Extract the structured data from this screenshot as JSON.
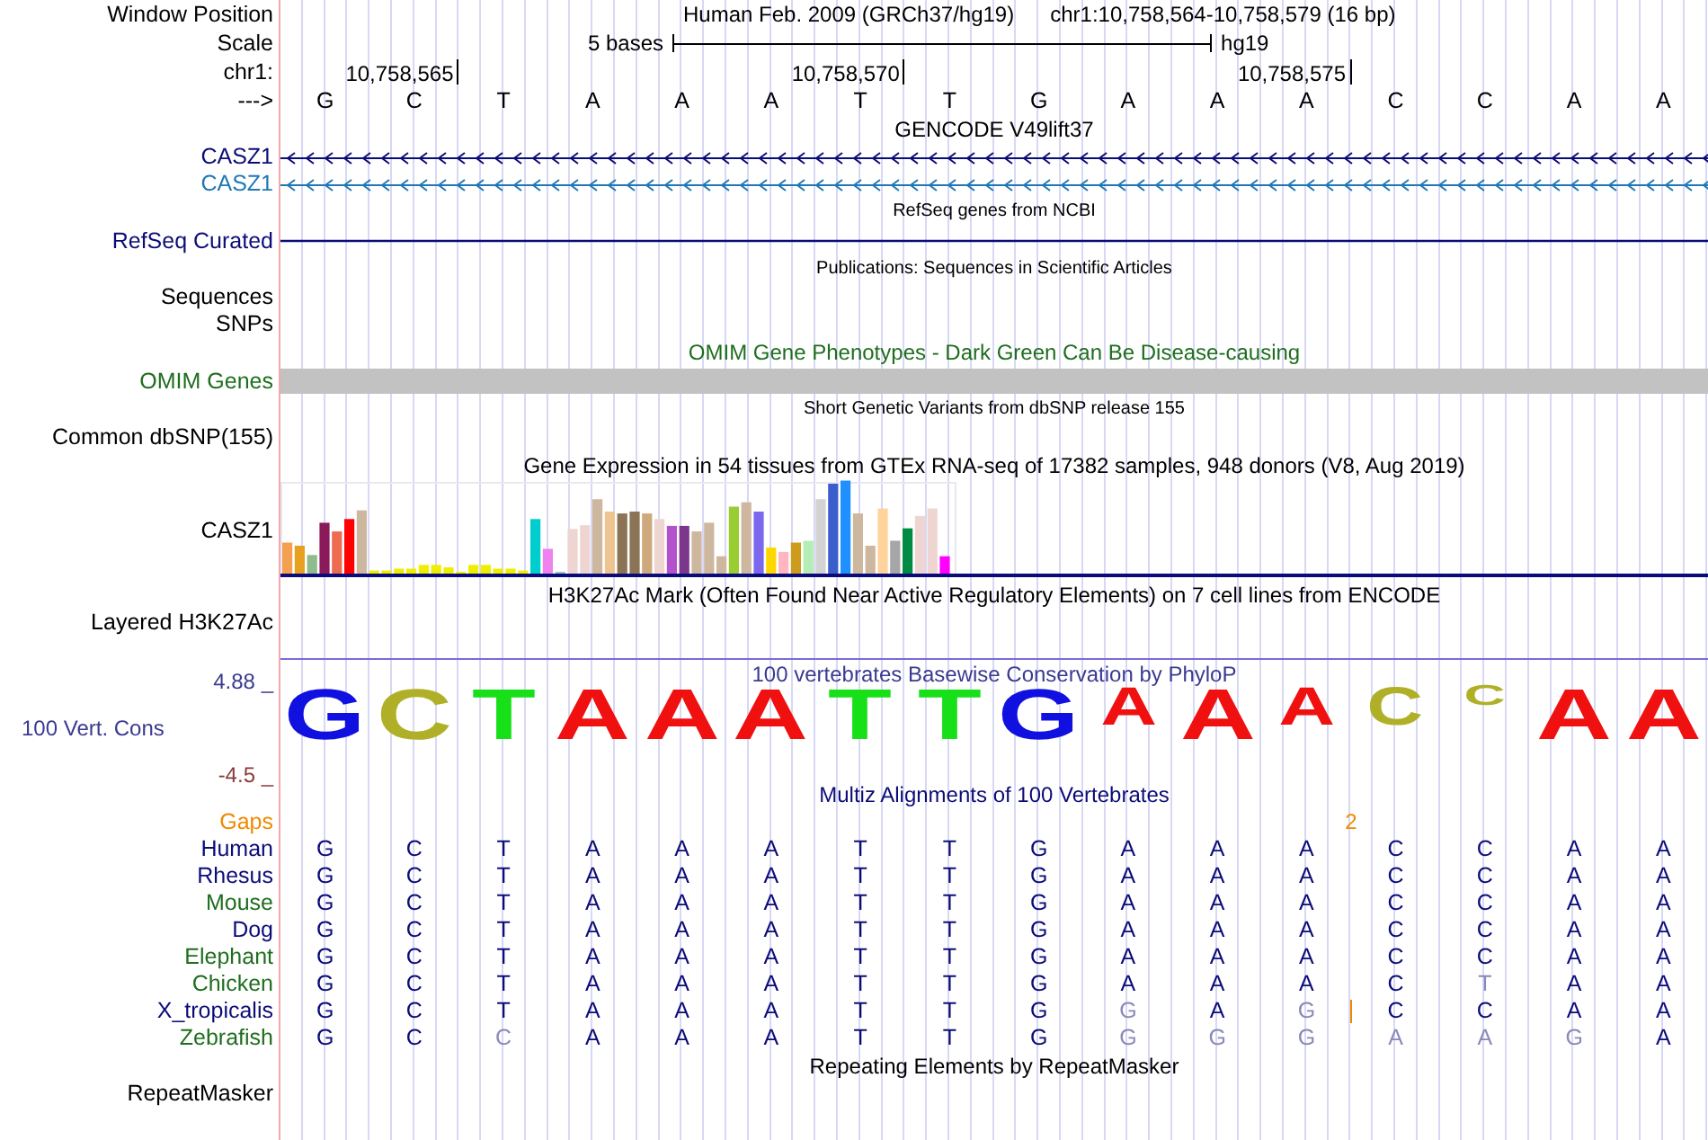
{
  "header": {
    "label": "Window Position",
    "assembly": "Human Feb. 2009 (GRCh37/hg19)",
    "position": "chr1:10,758,564-10,758,579 (16 bp)"
  },
  "scale": {
    "label": "Scale",
    "span": "5 bases",
    "assembly": "hg19"
  },
  "coordinates": {
    "label": "chr1:",
    "ticks": [
      "10,758,565",
      "10,758,570",
      "10,758,575"
    ]
  },
  "sequence": {
    "label": "--->",
    "bases": [
      "G",
      "C",
      "T",
      "A",
      "A",
      "A",
      "T",
      "T",
      "G",
      "A",
      "A",
      "A",
      "C",
      "C",
      "A",
      "A"
    ]
  },
  "tracks": [
    {
      "kind": "title",
      "text": "GENCODE V49lift37",
      "color": "#000000"
    },
    {
      "kind": "gene",
      "label": "CASZ1",
      "color": "#0c0c78"
    },
    {
      "kind": "gene",
      "label": "CASZ1",
      "color": "#1f78b4"
    },
    {
      "kind": "note",
      "text": "RefSeq genes from NCBI"
    },
    {
      "kind": "line",
      "label": "RefSeq Curated",
      "color": "#0c0c78"
    },
    {
      "kind": "note",
      "text": "Publications: Sequences in Scientific Articles"
    },
    {
      "kind": "label",
      "label": "Sequences"
    },
    {
      "kind": "label",
      "label": "SNPs"
    },
    {
      "kind": "title",
      "text": "OMIM Gene Phenotypes - Dark Green Can Be Disease-causing",
      "color": "#1e6e1e"
    },
    {
      "kind": "bar",
      "label": "OMIM Genes",
      "color": "#1e6e1e"
    },
    {
      "kind": "note",
      "text": "Short Genetic Variants from dbSNP release 155"
    },
    {
      "kind": "label",
      "label": "Common dbSNP(155)"
    },
    {
      "kind": "title",
      "text": "Gene Expression in 54 tissues from GTEx RNA-seq of 17382 samples, 948 donors (V8, Aug 2019)",
      "color": "#000000"
    },
    {
      "kind": "expression",
      "label": "CASZ1"
    },
    {
      "kind": "title",
      "text": "H3K27Ac Mark (Often Found Near Active Regulatory Elements) on 7 cell lines from ENCODE",
      "color": "#000000"
    },
    {
      "kind": "label",
      "label": "Layered H3K27Ac"
    },
    {
      "kind": "conservation",
      "label": "100 Vert. Cons",
      "title": "100 vertebrates Basewise Conservation by PhyloP",
      "max": "4.88 _",
      "min": "-4.5 _",
      "logo": [
        {
          "base": "G",
          "color": "#1010e0",
          "kind": "full"
        },
        {
          "base": "C",
          "color": "#b0b028",
          "kind": "full"
        },
        {
          "base": "T",
          "color": "#18e018",
          "kind": "full"
        },
        {
          "base": "A",
          "color": "#f01010",
          "kind": "full"
        },
        {
          "base": "A",
          "color": "#f01010",
          "kind": "full"
        },
        {
          "base": "A",
          "color": "#f01010",
          "kind": "full"
        },
        {
          "base": "T",
          "color": "#18e018",
          "kind": "full"
        },
        {
          "base": "T",
          "color": "#18e018",
          "kind": "full"
        },
        {
          "base": "G",
          "color": "#1010e0",
          "kind": "full"
        },
        {
          "base": "A",
          "color": "#f01010",
          "kind": "reduced"
        },
        {
          "base": "A",
          "color": "#f01010",
          "kind": "full"
        },
        {
          "base": "A",
          "color": "#f01010",
          "kind": "reduced"
        },
        {
          "base": "C",
          "color": "#b0b028",
          "kind": "reduced"
        },
        {
          "base": "C",
          "color": "#b0b028",
          "kind": "tiny"
        },
        {
          "base": "A",
          "color": "#f01010",
          "kind": "full"
        },
        {
          "base": "A",
          "color": "#f01010",
          "kind": "full"
        }
      ]
    },
    {
      "kind": "title",
      "text": "Multiz Alignments of 100 Vertebrates",
      "color": "#0c0c78"
    },
    {
      "kind": "gaps",
      "label": "Gaps",
      "color": "#ef8a00",
      "marks": [
        {
          "text": "2"
        }
      ]
    },
    {
      "kind": "species",
      "label": "Human",
      "color": "#0c0c78",
      "bases": [
        "G",
        "C",
        "T",
        "A",
        "A",
        "A",
        "T",
        "T",
        "G",
        "A",
        "A",
        "A",
        "C",
        "C",
        "A",
        "A"
      ],
      "faded": [
        false,
        false,
        false,
        false,
        false,
        false,
        false,
        false,
        false,
        false,
        false,
        false,
        false,
        false,
        false,
        false
      ]
    },
    {
      "kind": "species",
      "label": "Rhesus",
      "color": "#0c0c78",
      "bases": [
        "G",
        "C",
        "T",
        "A",
        "A",
        "A",
        "T",
        "T",
        "G",
        "A",
        "A",
        "A",
        "C",
        "C",
        "A",
        "A"
      ],
      "faded": [
        false,
        false,
        false,
        false,
        false,
        false,
        false,
        false,
        false,
        false,
        false,
        false,
        false,
        false,
        false,
        false
      ]
    },
    {
      "kind": "species",
      "label": "Mouse",
      "color": "#1e6e1e",
      "bases": [
        "G",
        "C",
        "T",
        "A",
        "A",
        "A",
        "T",
        "T",
        "G",
        "A",
        "A",
        "A",
        "C",
        "C",
        "A",
        "A"
      ],
      "faded": [
        false,
        false,
        false,
        false,
        false,
        false,
        false,
        false,
        false,
        false,
        false,
        false,
        false,
        false,
        false,
        false
      ]
    },
    {
      "kind": "species",
      "label": "Dog",
      "color": "#0c0c78",
      "bases": [
        "G",
        "C",
        "T",
        "A",
        "A",
        "A",
        "T",
        "T",
        "G",
        "A",
        "A",
        "A",
        "C",
        "C",
        "A",
        "A"
      ],
      "faded": [
        false,
        false,
        false,
        false,
        false,
        false,
        false,
        false,
        false,
        false,
        false,
        false,
        false,
        false,
        false,
        false
      ]
    },
    {
      "kind": "species",
      "label": "Elephant",
      "color": "#1e6e1e",
      "bases": [
        "G",
        "C",
        "T",
        "A",
        "A",
        "A",
        "T",
        "T",
        "G",
        "A",
        "A",
        "A",
        "C",
        "C",
        "A",
        "A"
      ],
      "faded": [
        false,
        false,
        false,
        false,
        false,
        false,
        false,
        false,
        false,
        false,
        false,
        false,
        false,
        false,
        false,
        false
      ]
    },
    {
      "kind": "species",
      "label": "Chicken",
      "color": "#1e6e1e",
      "bases": [
        "G",
        "C",
        "T",
        "A",
        "A",
        "A",
        "T",
        "T",
        "G",
        "A",
        "A",
        "A",
        "C",
        "T",
        "A",
        "A"
      ],
      "faded": [
        false,
        false,
        false,
        false,
        false,
        false,
        false,
        false,
        false,
        false,
        false,
        false,
        false,
        true,
        false,
        false
      ]
    },
    {
      "kind": "species",
      "label": "X_tropicalis",
      "color": "#0c0c78",
      "bases": [
        "G",
        "C",
        "T",
        "A",
        "A",
        "A",
        "T",
        "T",
        "G",
        "G",
        "A",
        "G",
        "C",
        "C",
        "A",
        "A"
      ],
      "faded": [
        false,
        false,
        false,
        false,
        false,
        false,
        false,
        false,
        false,
        true,
        false,
        true,
        false,
        false,
        false,
        false
      ],
      "insertion": true
    },
    {
      "kind": "species",
      "label": "Zebrafish",
      "color": "#1e6e1e",
      "bases": [
        "G",
        "C",
        "C",
        "A",
        "A",
        "A",
        "T",
        "T",
        "G",
        "G",
        "G",
        "G",
        "A",
        "A",
        "G",
        "A"
      ],
      "faded": [
        false,
        false,
        true,
        false,
        false,
        false,
        false,
        false,
        false,
        true,
        true,
        true,
        true,
        true,
        true,
        false
      ]
    },
    {
      "kind": "title",
      "text": "Repeating Elements by RepeatMasker",
      "color": "#000000"
    },
    {
      "kind": "label",
      "label": "RepeatMasker"
    }
  ]
}
